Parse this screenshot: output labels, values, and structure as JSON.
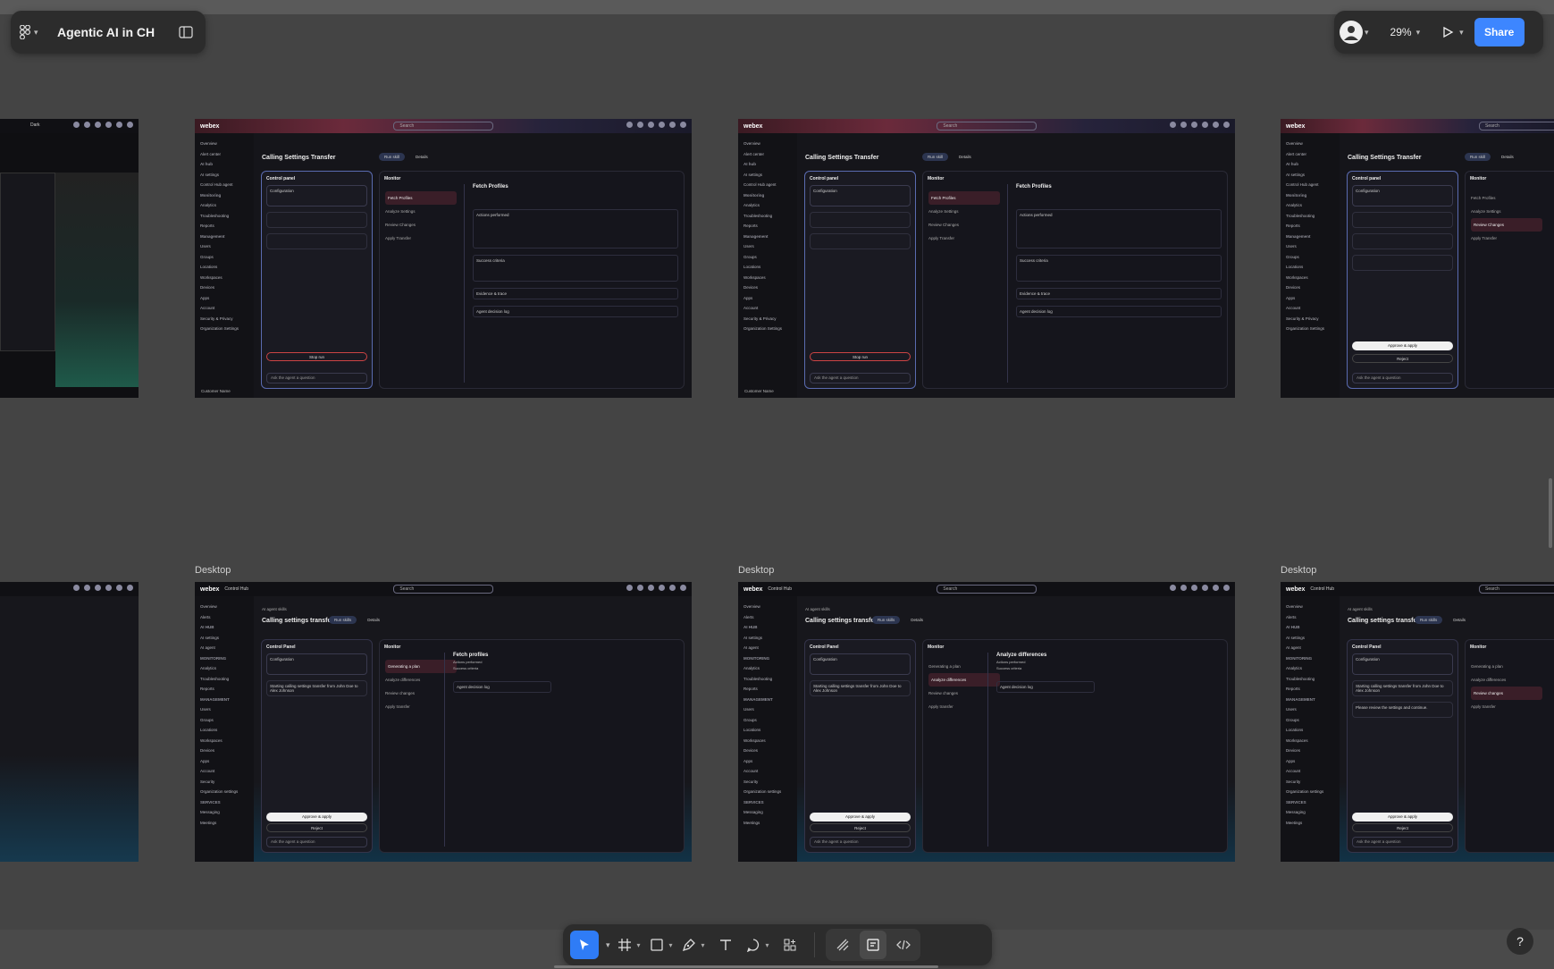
{
  "file": {
    "title": "Agentic AI in CH"
  },
  "header_right": {
    "zoom": "29%",
    "share_label": "Share"
  },
  "help": {
    "label": "?"
  },
  "frame_labels": [
    "Desktop",
    "Desktop",
    "Desktop"
  ],
  "frames_top": {
    "logo": "webex",
    "search": "Search",
    "dark_label": "Dark",
    "title": "Calling Settings Transfer",
    "tab_run": "Run skill",
    "tab_details": "Details",
    "control_panel": "Control panel",
    "configuration": "Configuration",
    "monitor": "Monitor",
    "fetch_profiles": "Fetch Profiles",
    "actions_performed": "Actions performed",
    "success_criteria": "Success criteria",
    "evidence": "Evidence & trace",
    "decision_log": "Agent decision log",
    "stop_run": "Stop run",
    "ask": "Ask the agent a question",
    "customer": "Customer Name",
    "approve": "Approve & apply",
    "reject": "Reject",
    "steps": [
      "Fetch Profiles",
      "Analyze Settings",
      "Review Changes",
      "Apply Transfer"
    ],
    "sidebar": [
      "Overview",
      "Alert center",
      "AI hub",
      "AI settings",
      "Control Hub agent",
      "Monitoring",
      "Analytics",
      "Troubleshooting",
      "Reports",
      "Management",
      "Users",
      "Groups",
      "Locations",
      "Workspaces",
      "Devices",
      "Apps",
      "Account",
      "Security & Privacy",
      "Organization Settings"
    ]
  },
  "frames_bottom": {
    "logo": "webex",
    "logo_suffix": "Control Hub",
    "search": "Search",
    "crumb": "AI agent skills",
    "title": "Calling settings transfer",
    "tab_run": "Run skills",
    "tab_details": "Details",
    "control_panel": "Control Panel",
    "configuration": "Configuration",
    "monitor": "Monitor",
    "starting": "Starting calling settings transfer from John Doe to Alex Johnson",
    "review_prompt": "Please review the settings and continue.",
    "approve": "Approve & apply",
    "reject": "Reject",
    "ask": "Ask the agent a question",
    "detail_1": "Fetch profiles",
    "detail_2": "Analyze differences",
    "actions_performed": "Actions performed",
    "success_criteria": "Success criteria",
    "decision_log": "Agent decision log",
    "customer": "Customer Name",
    "steps": [
      "Generating a plan",
      "Analyze differences",
      "Review changes",
      "Apply transfer"
    ],
    "sidebar": [
      "Overview",
      "Alerts",
      "AI HUB",
      "AI settings",
      "AI agent",
      "MONITORING",
      "Analytics",
      "Troubleshooting",
      "Reports",
      "MANAGEMENT",
      "Users",
      "Groups",
      "Locations",
      "Workspaces",
      "Devices",
      "Apps",
      "Account",
      "Security",
      "Organization settings",
      "SERVICES",
      "Messaging",
      "Meetings"
    ]
  }
}
